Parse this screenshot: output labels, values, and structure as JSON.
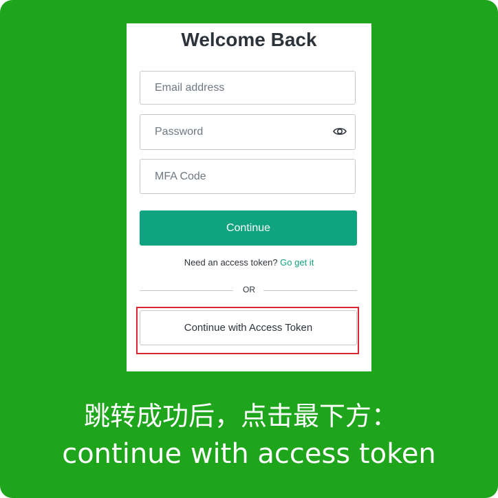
{
  "login": {
    "title": "Welcome Back",
    "email_placeholder": "Email address",
    "password_placeholder": "Password",
    "mfa_placeholder": "MFA Code",
    "continue_label": "Continue",
    "hint_text": "Need an access token? ",
    "hint_link": "Go get it",
    "divider_text": "OR",
    "token_button_label": "Continue with Access Token"
  },
  "caption": {
    "line1": "跳转成功后，点击最下方：",
    "line2": "continue with access token"
  },
  "colors": {
    "background": "#1ea51c",
    "primary": "#10a37f",
    "highlight": "#d9262f"
  }
}
